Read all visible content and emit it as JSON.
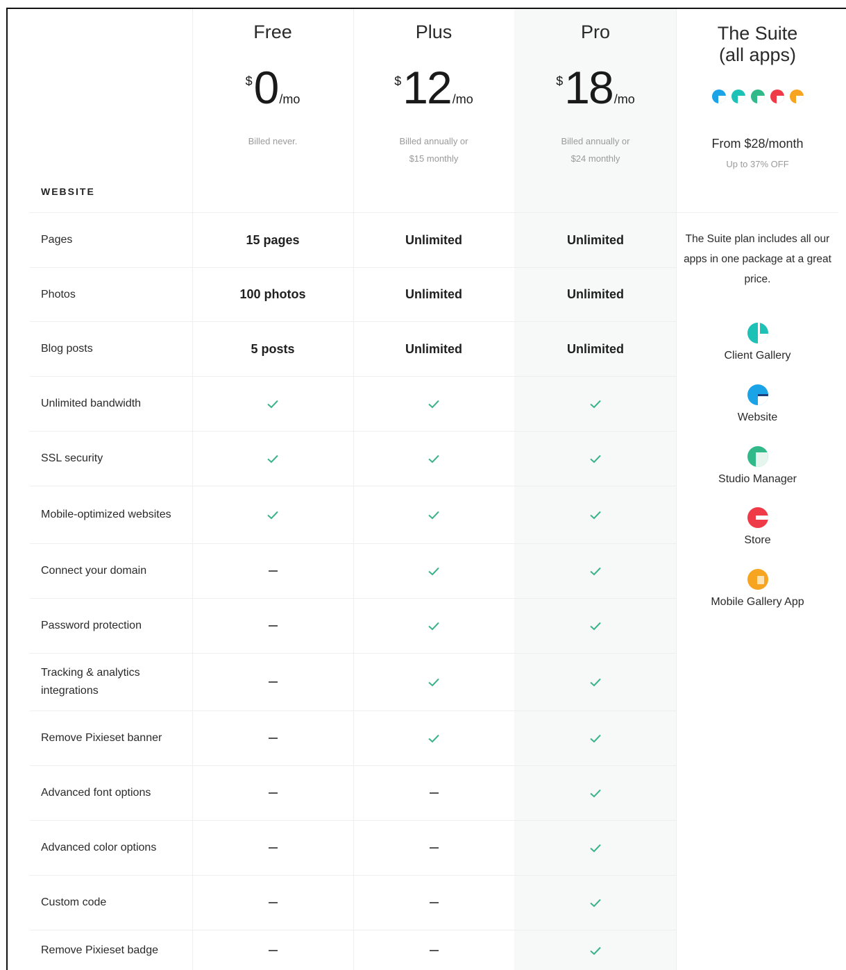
{
  "plans": [
    {
      "name": "Free",
      "currency": "$",
      "amount": "0",
      "period": "/mo",
      "billing_line1": "Billed never.",
      "billing_line2": ""
    },
    {
      "name": "Plus",
      "currency": "$",
      "amount": "12",
      "period": "/mo",
      "billing_line1": "Billed annually or",
      "billing_line2": "$15 monthly"
    },
    {
      "name": "Pro",
      "currency": "$",
      "amount": "18",
      "period": "/mo",
      "billing_line1": "Billed annually or",
      "billing_line2": "$24 monthly"
    }
  ],
  "suite": {
    "title_line1": "The Suite",
    "title_line2": "(all apps)",
    "from": "From $28/month",
    "discount": "Up to 37% OFF",
    "description": "The Suite plan includes all our apps in one package at a great price.",
    "apps": [
      {
        "label": "Client Gallery",
        "icon": "client-gallery-icon",
        "color": "#1ec1b5"
      },
      {
        "label": "Website",
        "icon": "website-icon",
        "color": "#1ba3e8"
      },
      {
        "label": "Studio Manager",
        "icon": "studio-manager-icon",
        "color": "#31b98a"
      },
      {
        "label": "Store",
        "icon": "store-icon",
        "color": "#ef3a47"
      },
      {
        "label": "Mobile Gallery App",
        "icon": "mobile-gallery-app-icon",
        "color": "#f7a421"
      }
    ]
  },
  "section_label": "WEBSITE",
  "features": [
    {
      "name": "Pages",
      "values": [
        "15 pages",
        "Unlimited",
        "Unlimited"
      ]
    },
    {
      "name": "Photos",
      "values": [
        "100 photos",
        "Unlimited",
        "Unlimited"
      ]
    },
    {
      "name": "Blog posts",
      "values": [
        "5 posts",
        "Unlimited",
        "Unlimited"
      ]
    },
    {
      "name": "Unlimited bandwidth",
      "values": [
        "check",
        "check",
        "check"
      ]
    },
    {
      "name": "SSL security",
      "values": [
        "check",
        "check",
        "check"
      ]
    },
    {
      "name": "Mobile-optimized websites",
      "values": [
        "check",
        "check",
        "check"
      ]
    },
    {
      "name": "Connect your domain",
      "values": [
        "dash",
        "check",
        "check"
      ]
    },
    {
      "name": "Password protection",
      "values": [
        "dash",
        "check",
        "check"
      ]
    },
    {
      "name": "Tracking & analytics integrations",
      "values": [
        "dash",
        "check",
        "check"
      ]
    },
    {
      "name": "Remove Pixieset banner",
      "values": [
        "dash",
        "check",
        "check"
      ]
    },
    {
      "name": "Advanced font options",
      "values": [
        "dash",
        "dash",
        "check"
      ]
    },
    {
      "name": "Advanced color options",
      "values": [
        "dash",
        "dash",
        "check"
      ]
    },
    {
      "name": "Custom code",
      "values": [
        "dash",
        "dash",
        "check"
      ]
    },
    {
      "name": "Remove Pixieset badge",
      "values": [
        "dash",
        "dash",
        "check"
      ]
    }
  ],
  "colors": {
    "check": "#3bb38a",
    "dash": "#555555",
    "pro_column_bg": "#f6f9f8"
  }
}
